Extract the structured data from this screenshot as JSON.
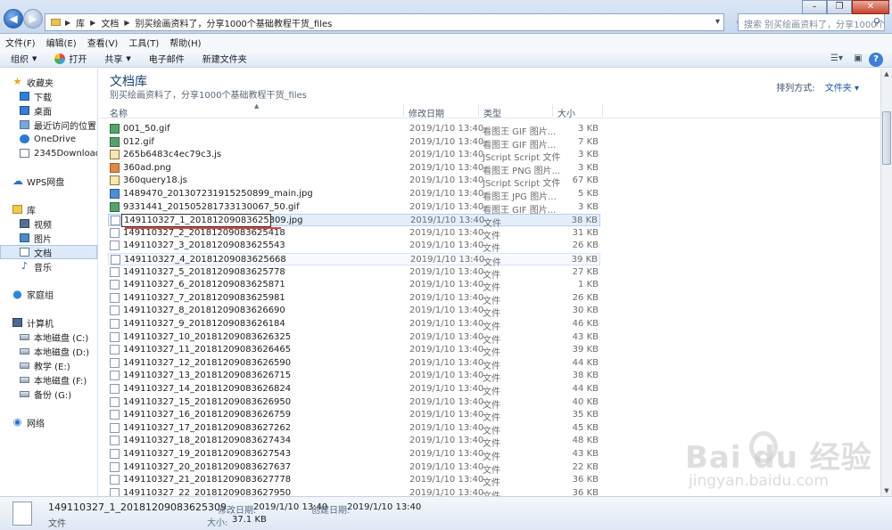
{
  "address": {
    "crumbs": [
      "库",
      "文档",
      "别买绘画资料了，分享1000个基础教程干货_files"
    ]
  },
  "search": {
    "placeholder": "搜索 别买绘画资料了，分享1000个基础..."
  },
  "menu": [
    "文件(F)",
    "编辑(E)",
    "查看(V)",
    "工具(T)",
    "帮助(H)"
  ],
  "toolbar": {
    "organize": "组织",
    "open": "打开",
    "share": "共享",
    "email": "电子邮件",
    "new_folder": "新建文件夹"
  },
  "sidebar": {
    "favorites": "收藏夹",
    "fav_items": [
      "下载",
      "桌面",
      "最近访问的位置",
      "OneDrive",
      "2345Downloads"
    ],
    "wps": "WPS网盘",
    "library": "库",
    "lib_items": [
      "视频",
      "图片",
      "文档",
      "音乐"
    ],
    "homegroup": "家庭组",
    "computer": "计算机",
    "drives": [
      "本地磁盘 (C:)",
      "本地磁盘 (D:)",
      "教学 (E:)",
      "本地磁盘 (F:)",
      "备份 (G:)"
    ],
    "network": "网络"
  },
  "main": {
    "title": "文档库",
    "subtitle": "别买绘画资料了，分享1000个基础教程干货_files",
    "arrange_label": "排列方式:",
    "arrange_value": "文件夹",
    "columns": [
      "名称",
      "修改日期",
      "类型",
      "大小"
    ]
  },
  "files": [
    {
      "name": "001_50.gif",
      "date": "2019/1/10 13:40",
      "type": "看图王 GIF 图片...",
      "size": "3 KB",
      "kind": "gif"
    },
    {
      "name": "012.gif",
      "date": "2019/1/10 13:40",
      "type": "看图王 GIF 图片...",
      "size": "7 KB",
      "kind": "gif"
    },
    {
      "name": "265b6483c4ec79c3.js",
      "date": "2019/1/10 13:40",
      "type": "JScript Script 文件",
      "size": "3 KB",
      "kind": "js"
    },
    {
      "name": "360ad.png",
      "date": "2019/1/10 13:40",
      "type": "看图王 PNG 图片...",
      "size": "3 KB",
      "kind": "png"
    },
    {
      "name": "360query18.js",
      "date": "2019/1/10 13:40",
      "type": "JScript Script 文件",
      "size": "67 KB",
      "kind": "js"
    },
    {
      "name": "1489470_2013072319152508​99_main.jpg",
      "date": "2019/1/10 13:40",
      "type": "看图王 JPG 图片...",
      "size": "5 KB",
      "kind": "jpg"
    },
    {
      "name": "9331441_201505281733130067_50.gif",
      "date": "2019/1/10 13:40",
      "type": "看图王 GIF 图片...",
      "size": "3 KB",
      "kind": "gif"
    },
    {
      "name": "149110327_1_20181209083625309.jpg",
      "date": "2019/1/10 13:40",
      "type": "文件",
      "size": "38 KB",
      "kind": "file"
    },
    {
      "name": "149110327_2_20181209083625418",
      "date": "2019/1/10 13:40",
      "type": "文件",
      "size": "31 KB",
      "kind": "file"
    },
    {
      "name": "149110327_3_20181209083625543",
      "date": "2019/1/10 13:40",
      "type": "文件",
      "size": "26 KB",
      "kind": "file"
    },
    {
      "name": "149110327_4_20181209083625668",
      "date": "2019/1/10 13:40",
      "type": "文件",
      "size": "39 KB",
      "kind": "file"
    },
    {
      "name": "149110327_5_20181209083625778",
      "date": "2019/1/10 13:40",
      "type": "文件",
      "size": "27 KB",
      "kind": "file"
    },
    {
      "name": "149110327_6_20181209083625871",
      "date": "2019/1/10 13:40",
      "type": "文件",
      "size": "1 KB",
      "kind": "file"
    },
    {
      "name": "149110327_7_20181209083625981",
      "date": "2019/1/10 13:40",
      "type": "文件",
      "size": "26 KB",
      "kind": "file"
    },
    {
      "name": "149110327_8_20181209083626690",
      "date": "2019/1/10 13:40",
      "type": "文件",
      "size": "30 KB",
      "kind": "file"
    },
    {
      "name": "149110327_9_20181209083626184",
      "date": "2019/1/10 13:40",
      "type": "文件",
      "size": "46 KB",
      "kind": "file"
    },
    {
      "name": "149110327_10_20181209083626325",
      "date": "2019/1/10 13:40",
      "type": "文件",
      "size": "43 KB",
      "kind": "file"
    },
    {
      "name": "149110327_11_20181209083626465",
      "date": "2019/1/10 13:40",
      "type": "文件",
      "size": "39 KB",
      "kind": "file"
    },
    {
      "name": "149110327_12_20181209083626590",
      "date": "2019/1/10 13:40",
      "type": "文件",
      "size": "44 KB",
      "kind": "file"
    },
    {
      "name": "149110327_13_20181209083626715",
      "date": "2019/1/10 13:40",
      "type": "文件",
      "size": "38 KB",
      "kind": "file"
    },
    {
      "name": "149110327_14_20181209083626824",
      "date": "2019/1/10 13:40",
      "type": "文件",
      "size": "44 KB",
      "kind": "file"
    },
    {
      "name": "149110327_15_20181209083626950",
      "date": "2019/1/10 13:40",
      "type": "文件",
      "size": "40 KB",
      "kind": "file"
    },
    {
      "name": "149110327_16_20181209083626759",
      "date": "2019/1/10 13:40",
      "type": "文件",
      "size": "35 KB",
      "kind": "file"
    },
    {
      "name": "149110327_17_20181209083627262",
      "date": "2019/1/10 13:40",
      "type": "文件",
      "size": "45 KB",
      "kind": "file"
    },
    {
      "name": "149110327_18_20181209083627434",
      "date": "2019/1/10 13:40",
      "type": "文件",
      "size": "48 KB",
      "kind": "file"
    },
    {
      "name": "149110327_19_20181209083627543",
      "date": "2019/1/10 13:40",
      "type": "文件",
      "size": "43 KB",
      "kind": "file"
    },
    {
      "name": "149110327_20_20181209083627637",
      "date": "2019/1/10 13:40",
      "type": "文件",
      "size": "22 KB",
      "kind": "file"
    },
    {
      "name": "149110327_21_20181209083627778",
      "date": "2019/1/10 13:40",
      "type": "文件",
      "size": "36 KB",
      "kind": "file"
    },
    {
      "name": "149110327_22_20181209083627950",
      "date": "2019/1/10 13:40",
      "type": "文件",
      "size": "36 KB",
      "kind": "file"
    }
  ],
  "rename": {
    "value": "149110327_1_20181209083625309.jpg"
  },
  "details": {
    "name": "149110327_1_20181209083625309",
    "type": "文件",
    "modified_label": "修改日期:",
    "modified_value": "2019/1/10 13:40",
    "created_label": "创建日期:",
    "created_value": "2019/1/10 13:40",
    "size_label": "大小:",
    "size_value": "37.1 KB"
  },
  "watermark": {
    "brand": "Bai  du 经验",
    "url": "jingyan.baidu.com"
  }
}
